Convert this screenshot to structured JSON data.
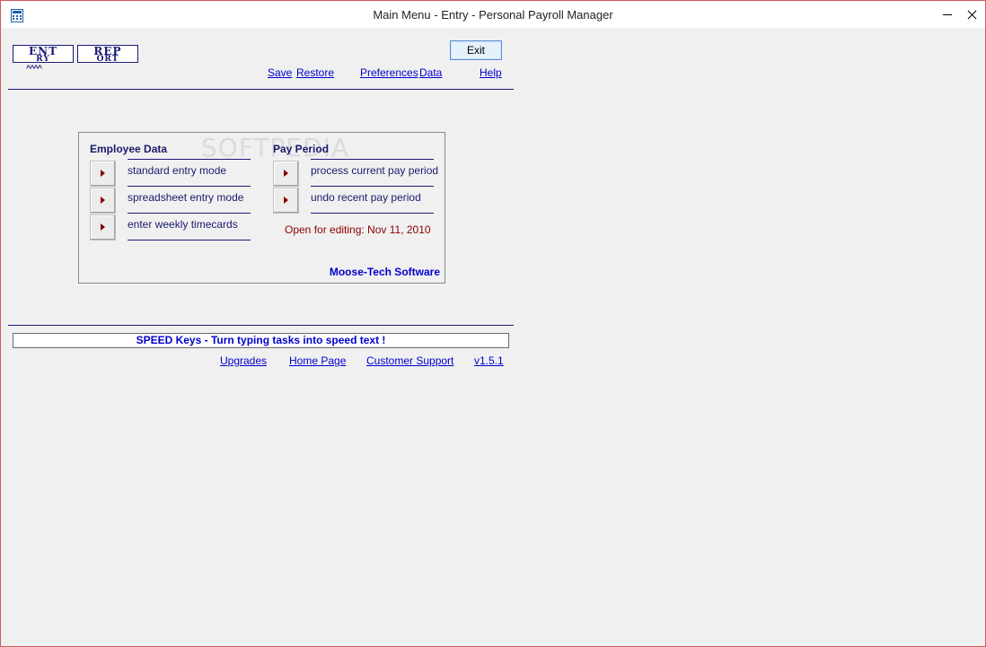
{
  "window": {
    "title": "Main Menu - Entry - Personal Payroll Manager"
  },
  "toolbar": {
    "tab_entry_top": "ENT",
    "tab_entry_bottom": "RY",
    "tab_report_top": "REP",
    "tab_report_bottom": "ORT",
    "active_marker": "^^^^",
    "exit_label": "Exit",
    "links": {
      "save": "Save",
      "restore": "Restore",
      "preferences": "Preferences",
      "data": "Data",
      "help": "Help"
    }
  },
  "panel": {
    "watermark": "SOFTPEDIA",
    "employee_title": "Employee Data",
    "employee_items": [
      "standard entry mode",
      "spreadsheet entry mode",
      "enter weekly timecards"
    ],
    "pay_title": "Pay Period",
    "pay_items": [
      "process current pay period",
      "undo recent pay period"
    ],
    "open_status": "Open for editing: Nov 11, 2010",
    "company": "Moose-Tech Software"
  },
  "footer": {
    "speed_text": "SPEED Keys - Turn typing tasks into speed text !",
    "links": {
      "upgrades": "Upgrades",
      "home_page": "Home Page",
      "support": "Customer Support",
      "version": "v1.5.1"
    }
  },
  "colors": {
    "navy": "#1a1a7a",
    "link": "#0000cc",
    "status_red": "#8b0000",
    "window_border": "#d05a5a"
  }
}
